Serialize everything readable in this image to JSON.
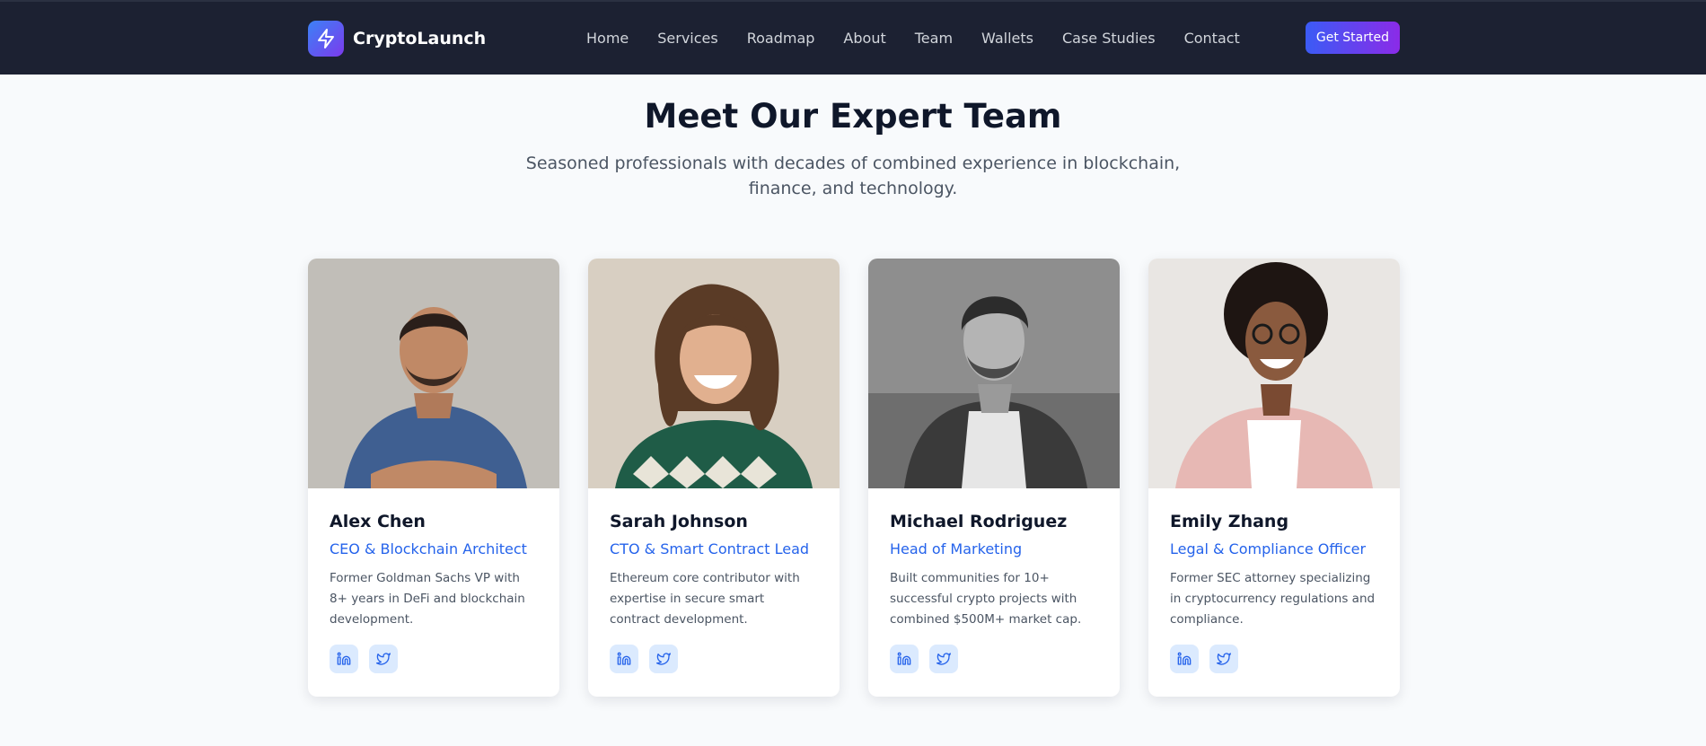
{
  "brand": {
    "name": "CryptoLaunch",
    "logo_icon": "lightning-bolt-icon"
  },
  "nav": {
    "links": [
      "Home",
      "Services",
      "Roadmap",
      "About",
      "Team",
      "Wallets",
      "Case Studies",
      "Contact"
    ],
    "cta_label": "Get Started"
  },
  "team": {
    "title": "Meet Our Expert Team",
    "subtitle": "Seasoned professionals with decades of combined experience in blockchain, finance, and technology.",
    "members": [
      {
        "name": "Alex Chen",
        "role": "CEO & Blockchain Architect",
        "bio": "Former Goldman Sachs VP with 8+ years in DeFi and blockchain development.",
        "socials": [
          "linkedin-icon",
          "twitter-icon"
        ]
      },
      {
        "name": "Sarah Johnson",
        "role": "CTO & Smart Contract Lead",
        "bio": "Ethereum core contributor with expertise in secure smart contract development.",
        "socials": [
          "linkedin-icon",
          "twitter-icon"
        ]
      },
      {
        "name": "Michael Rodriguez",
        "role": "Head of Marketing",
        "bio": "Built communities for 10+ successful crypto projects with combined $500M+ market cap.",
        "socials": [
          "linkedin-icon",
          "twitter-icon"
        ]
      },
      {
        "name": "Emily Zhang",
        "role": "Legal & Compliance Officer",
        "bio": "Former SEC attorney specializing in cryptocurrency regulations and compliance.",
        "socials": [
          "linkedin-icon",
          "twitter-icon"
        ]
      }
    ]
  },
  "colors": {
    "nav_bg": "#1c2132",
    "accent": "#2563eb",
    "cta_gradient_start": "#3b5bf5",
    "cta_gradient_end": "#8b2be8",
    "page_bg": "#f8fafc"
  }
}
